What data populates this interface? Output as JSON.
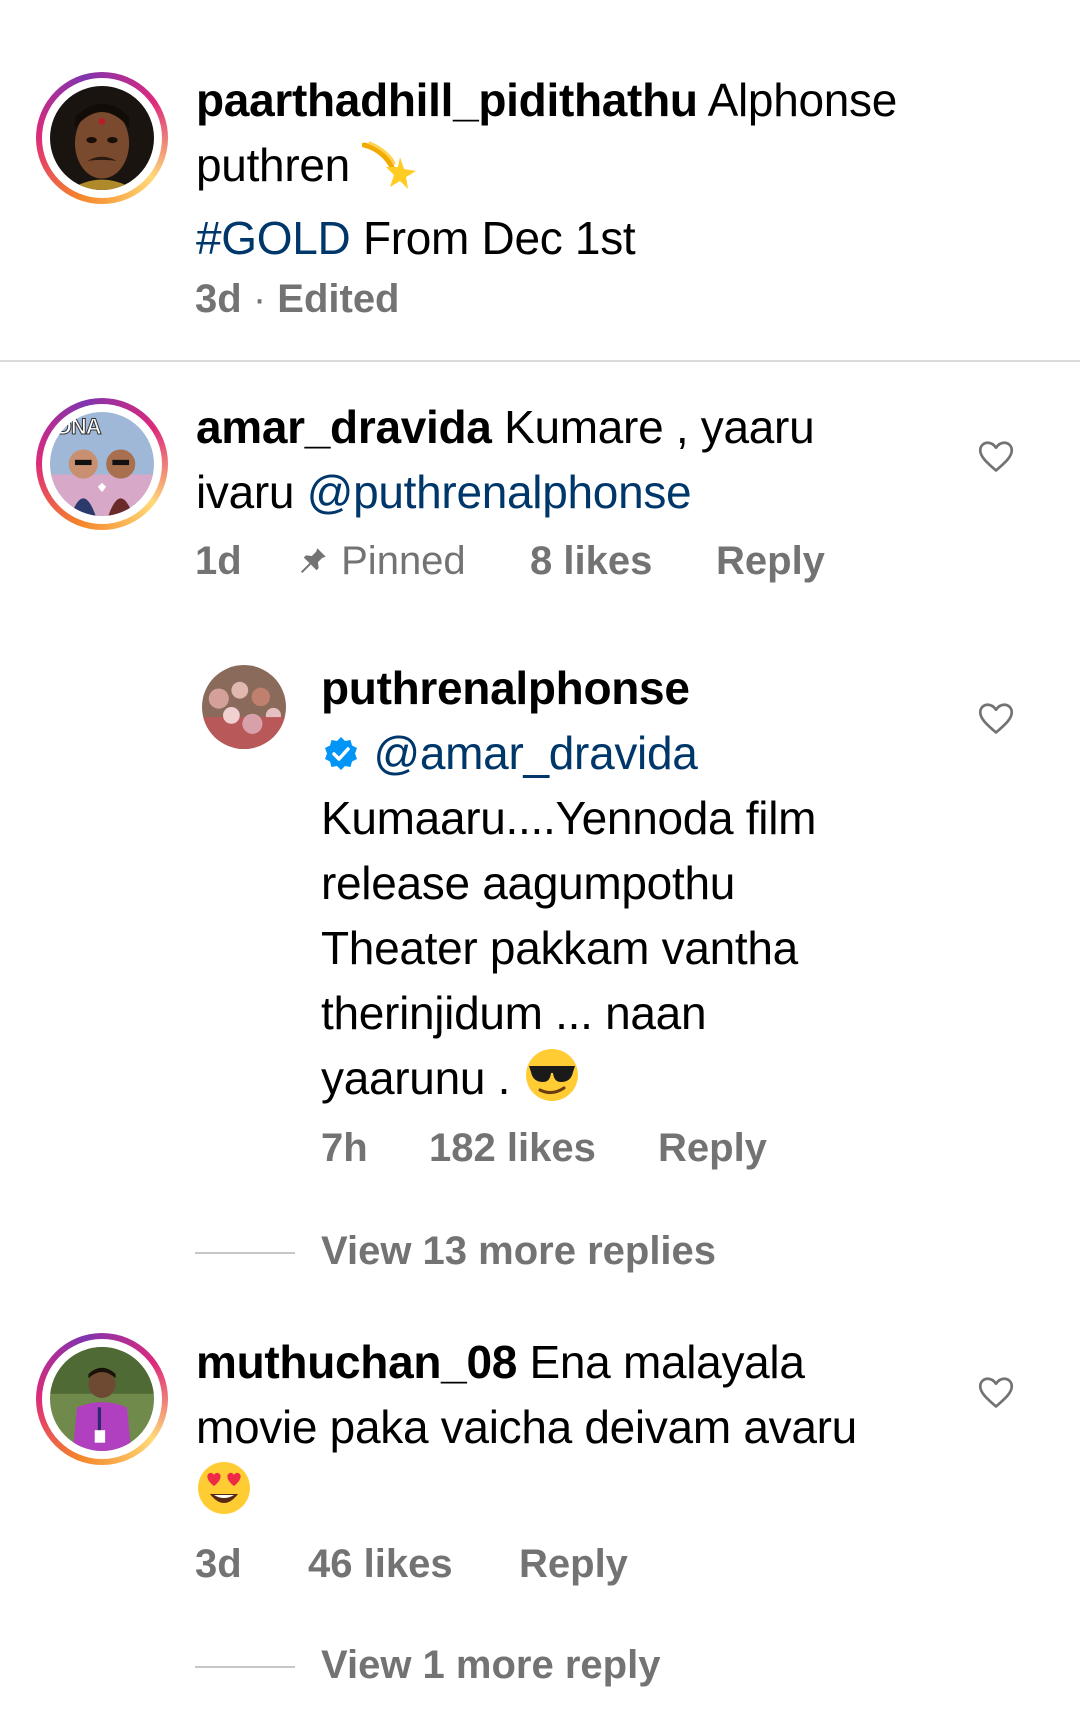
{
  "caption": {
    "username": "paarthadhill_pidithathu",
    "text_line1_rest": "Alphonse",
    "text_line2": "puthren",
    "text_line2_emoji": "dizzy-emoji",
    "hashtag": "#GOLD",
    "text_line3_rest": "From Dec 1st",
    "time": "3d",
    "separator": "·",
    "edited": "Edited"
  },
  "comments": [
    {
      "username": "amar_dravida",
      "line1_rest": "Kumare , yaaru",
      "line2_text": "ivaru",
      "mention": "@puthrenalphonse",
      "time": "1d",
      "pinned_label": "Pinned",
      "likes": "8 likes",
      "reply_label": "Reply",
      "avatar_badge": "DNA",
      "reply": {
        "username": "puthrenalphonse",
        "mention": "@amar_dravida",
        "lines": [
          "Kumaaru....Yennoda film",
          "release aagumpothu",
          "Theater pakkam vantha",
          "therinjidum ... naan",
          "yaarunu ."
        ],
        "emoji": "sunglasses-emoji",
        "time": "7h",
        "likes": "182 likes",
        "reply_label": "Reply"
      },
      "view_more": "View 13 more replies"
    },
    {
      "username": "muthuchan_08",
      "line1_rest": "Ena malayala",
      "line2": "movie paka vaicha deivam avaru",
      "emoji": "heart-eyes-emoji",
      "time": "3d",
      "likes": "46 likes",
      "reply_label": "Reply",
      "view_more": "View 1 more reply"
    }
  ],
  "colors": {
    "link": "#00376b",
    "meta": "#737373",
    "divider": "#dbdbdb",
    "verified": "#0095f6"
  }
}
